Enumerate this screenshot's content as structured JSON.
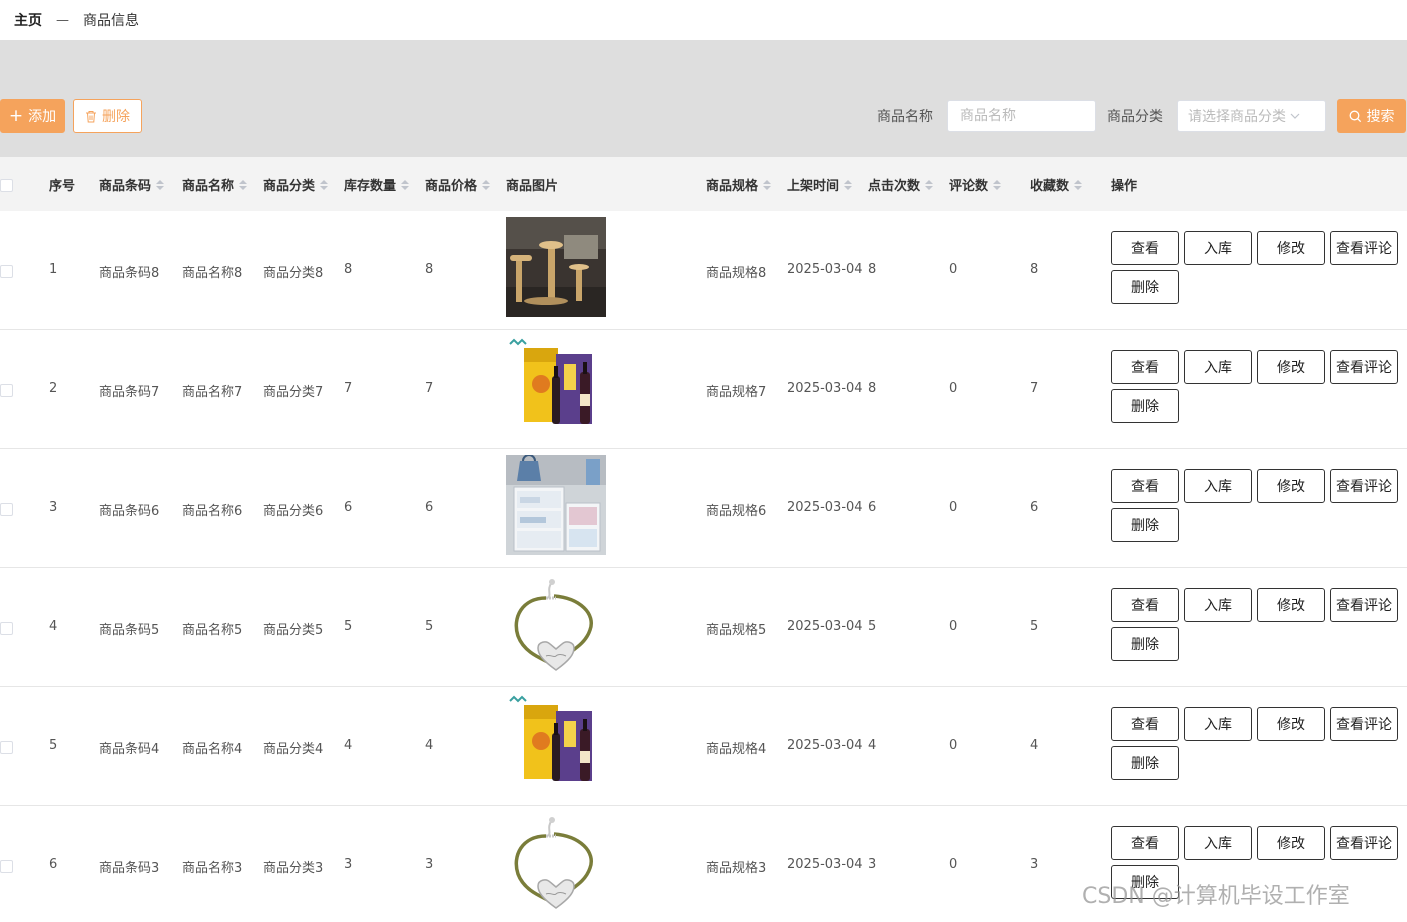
{
  "breadcrumb": {
    "home": "主页",
    "separator": "—",
    "current": "商品信息"
  },
  "toolbar": {
    "add_label": "添加",
    "delete_label": "删除",
    "name_label": "商品名称",
    "name_placeholder": "商品名称",
    "category_label": "商品分类",
    "category_placeholder": "请选择商品分类",
    "search_label": "搜索"
  },
  "table": {
    "headers": {
      "index": "序号",
      "barcode": "商品条码",
      "name": "商品名称",
      "category": "商品分类",
      "stock": "库存数量",
      "price": "商品价格",
      "image": "商品图片",
      "spec": "商品规格",
      "listed": "上架时间",
      "clicks": "点击次数",
      "comments": "评论数",
      "favorites": "收藏数",
      "actions": "操作"
    },
    "actions": {
      "view": "查看",
      "stock_in": "入库",
      "edit": "修改",
      "view_comments": "查看评论",
      "delete": "删除"
    },
    "rows": [
      {
        "index": "1",
        "barcode": "商品条码8",
        "name": "商品名称8",
        "category": "商品分类8",
        "stock": "8",
        "price": "8",
        "image": "cat-tree-photo",
        "spec": "商品规格8",
        "listed": "2025-03-04",
        "clicks": "8",
        "comments": "0",
        "favorites": "8"
      },
      {
        "index": "2",
        "barcode": "商品条码7",
        "name": "商品名称7",
        "category": "商品分类7",
        "stock": "7",
        "price": "7",
        "image": "wine-gift-box-photo",
        "spec": "商品规格7",
        "listed": "2025-03-04",
        "clicks": "8",
        "comments": "0",
        "favorites": "7"
      },
      {
        "index": "3",
        "barcode": "商品条码6",
        "name": "商品名称6",
        "category": "商品分类6",
        "stock": "6",
        "price": "6",
        "image": "storage-drawers-photo",
        "spec": "商品规格6",
        "listed": "2025-03-04",
        "clicks": "6",
        "comments": "0",
        "favorites": "6"
      },
      {
        "index": "4",
        "barcode": "商品条码5",
        "name": "商品名称5",
        "category": "商品分类5",
        "stock": "5",
        "price": "5",
        "image": "bracelet-photo",
        "spec": "商品规格5",
        "listed": "2025-03-04",
        "clicks": "5",
        "comments": "0",
        "favorites": "5"
      },
      {
        "index": "5",
        "barcode": "商品条码4",
        "name": "商品名称4",
        "category": "商品分类4",
        "stock": "4",
        "price": "4",
        "image": "wine-gift-box-photo",
        "spec": "商品规格4",
        "listed": "2025-03-04",
        "clicks": "4",
        "comments": "0",
        "favorites": "4"
      },
      {
        "index": "6",
        "barcode": "商品条码3",
        "name": "商品名称3",
        "category": "商品分类3",
        "stock": "3",
        "price": "3",
        "image": "bracelet-photo",
        "spec": "商品规格3",
        "listed": "2025-03-04",
        "clicks": "3",
        "comments": "0",
        "favorites": "3"
      }
    ]
  },
  "watermark": "CSDN @计算机毕设工作室",
  "colors": {
    "accent": "#f5a35c",
    "header_bg": "#f3f3f3",
    "page_bg": "#dedede"
  }
}
